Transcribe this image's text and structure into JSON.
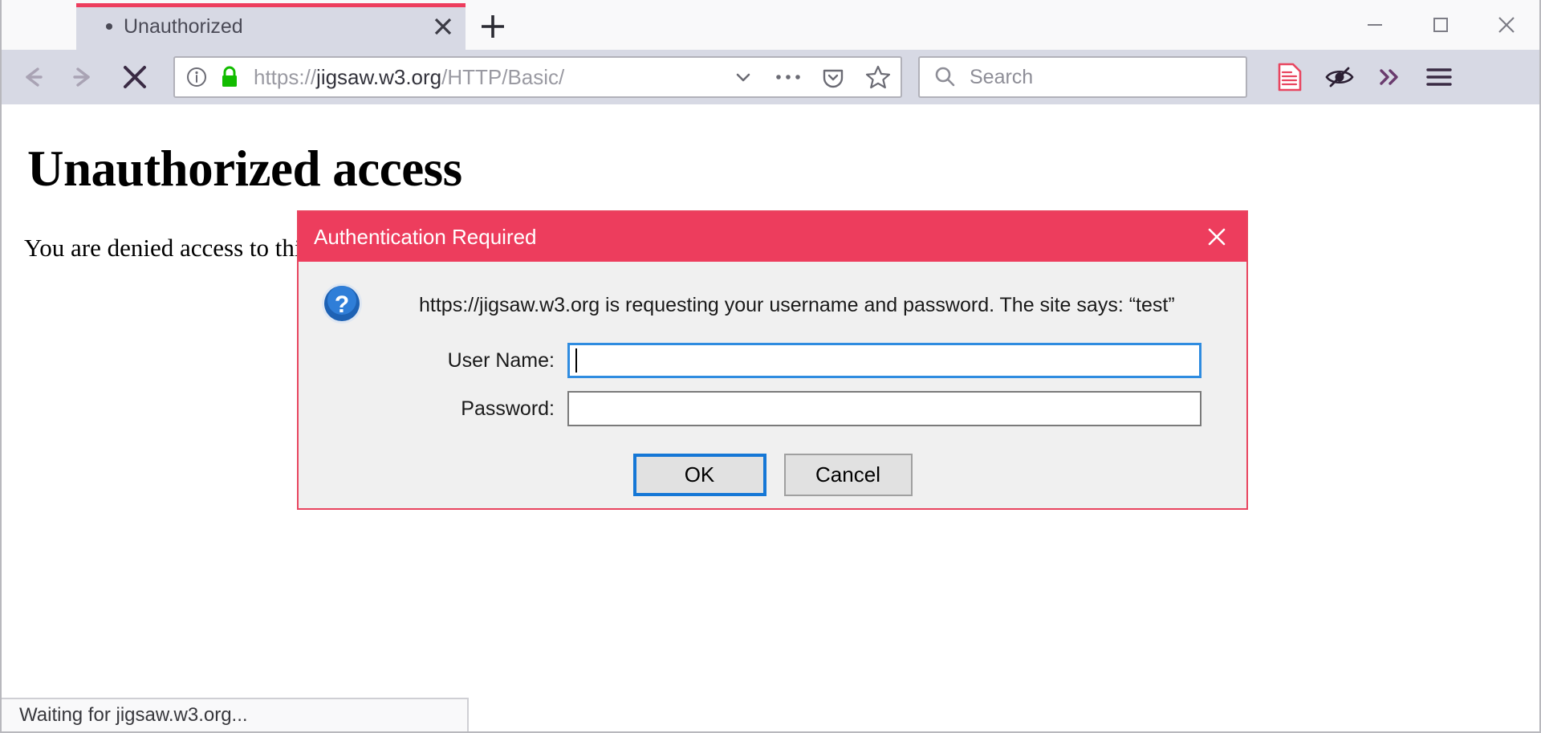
{
  "window": {
    "controls": {
      "minimize": "minimize-icon",
      "maximize": "maximize-icon",
      "close": "close-icon"
    }
  },
  "tabs": {
    "active": {
      "title": "Unauthorized",
      "close_label": "✕"
    },
    "new_tab_label": "+"
  },
  "navbar": {
    "back_label": "←",
    "forward_label": "→",
    "stop_label": "✕",
    "url": {
      "scheme": "https://",
      "host": "jigsaw.w3.org",
      "path": "/HTTP/Basic/",
      "full": "https://jigsaw.w3.org/HTTP/Basic/"
    },
    "search": {
      "placeholder": "Search",
      "value": ""
    },
    "icons": {
      "identity_info": "info-circle-icon",
      "identity_lock": "lock-icon",
      "dropmarker": "chevron-down-icon",
      "page_actions": "ellipsis-icon",
      "pocket": "pocket-icon",
      "bookmark": "star-icon",
      "reader_mode": "reader-mode-icon",
      "tracking_protection": "eye-slash-icon",
      "overflow": "double-chevron-right-icon",
      "menu": "hamburger-menu-icon"
    }
  },
  "page": {
    "heading": "Unauthorized access",
    "paragraph": "You are denied access to this resource."
  },
  "status_bar": {
    "text": "Waiting for jigsaw.w3.org..."
  },
  "dialog": {
    "title": "Authentication Required",
    "close_label": "✕",
    "icon": "question-mark-icon",
    "message": "https://jigsaw.w3.org is requesting your username and password. The site says: “test”",
    "fields": [
      {
        "label": "User Name:",
        "value": "",
        "focused": true
      },
      {
        "label": "Password:",
        "value": "",
        "focused": false
      }
    ],
    "buttons": {
      "ok": "OK",
      "cancel": "Cancel"
    }
  },
  "colors": {
    "accent_red": "#ed3d5d",
    "chrome_bg": "#d7d9e4",
    "focus_blue": "#1577d6",
    "lock_green": "#12bc00"
  }
}
